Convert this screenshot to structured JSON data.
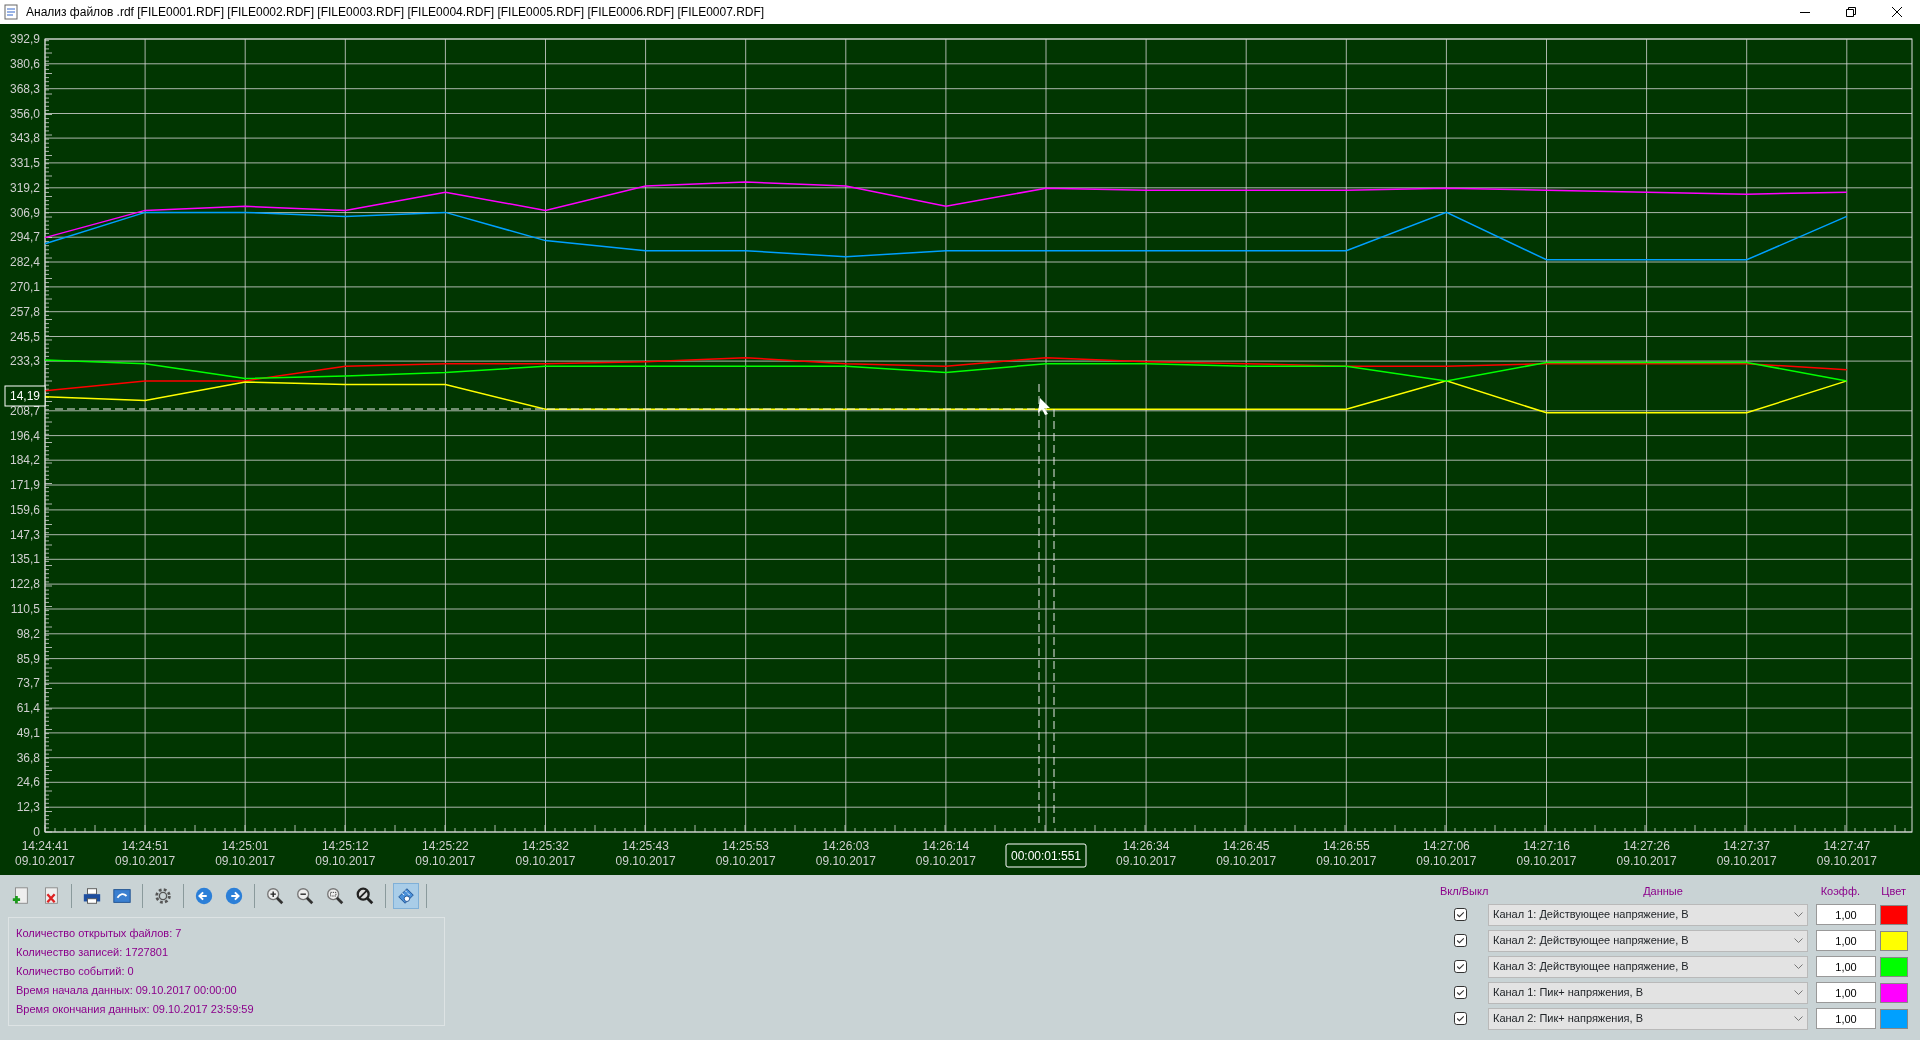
{
  "window": {
    "title": "Анализ файлов .rdf [FILE0001.RDF] [FILE0002.RDF] [FILE0003.RDF] [FILE0004.RDF] [FILE0005.RDF] [FILE0006.RDF] [FILE0007.RDF]"
  },
  "chart": {
    "cursor": {
      "y_value": "14,19",
      "time": "00:00:01:551"
    },
    "chart_data": {
      "type": "line",
      "grid": true,
      "ylim": [
        0,
        392.9
      ],
      "ref_lines": [
        {
          "axis": "y",
          "value": 209.6
        }
      ],
      "categories": [
        "14:24:41\n09.10.2017",
        "14:24:51\n09.10.2017",
        "14:25:01\n09.10.2017",
        "14:25:12\n09.10.2017",
        "14:25:22\n09.10.2017",
        "14:25:32\n09.10.2017",
        "14:25:43\n09.10.2017",
        "14:25:53\n09.10.2017",
        "14:26:03\n09.10.2017",
        "14:26:14\n09.10.2017",
        null,
        "14:26:34\n09.10.2017",
        "14:26:45\n09.10.2017",
        "14:26:55\n09.10.2017",
        "14:27:06\n09.10.2017",
        "14:27:16\n09.10.2017",
        "14:27:26\n09.10.2017",
        "14:27:37\n09.10.2017",
        "14:27:47\n09.10.2017"
      ],
      "yticks": [
        {
          "value": 392.9,
          "label": "392,9"
        },
        {
          "value": 380.6,
          "label": "380,6"
        },
        {
          "value": 368.3,
          "label": "368,3"
        },
        {
          "value": 356.0,
          "label": "356,0"
        },
        {
          "value": 343.8,
          "label": "343,8"
        },
        {
          "value": 331.5,
          "label": "331,5"
        },
        {
          "value": 319.2,
          "label": "319,2"
        },
        {
          "value": 306.9,
          "label": "306,9"
        },
        {
          "value": 294.7,
          "label": "294,7"
        },
        {
          "value": 282.4,
          "label": "282,4"
        },
        {
          "value": 270.1,
          "label": "270,1"
        },
        {
          "value": 257.8,
          "label": "257,8"
        },
        {
          "value": 245.5,
          "label": "245,5"
        },
        {
          "value": 233.3,
          "label": "233,3"
        },
        {
          "value": 208.7,
          "label": "208,7"
        },
        {
          "value": 196.4,
          "label": "196,4"
        },
        {
          "value": 184.2,
          "label": "184,2"
        },
        {
          "value": 171.9,
          "label": "171,9"
        },
        {
          "value": 159.6,
          "label": "159,6"
        },
        {
          "value": 147.3,
          "label": "147,3"
        },
        {
          "value": 135.1,
          "label": "135,1"
        },
        {
          "value": 122.8,
          "label": "122,8"
        },
        {
          "value": 110.5,
          "label": "110,5"
        },
        {
          "value": 98.2,
          "label": "98,2"
        },
        {
          "value": 85.9,
          "label": "85,9"
        },
        {
          "value": 73.7,
          "label": "73,7"
        },
        {
          "value": 61.4,
          "label": "61,4"
        },
        {
          "value": 49.1,
          "label": "49,1"
        },
        {
          "value": 36.8,
          "label": "36,8"
        },
        {
          "value": 24.6,
          "label": "24,6"
        },
        {
          "value": 12.3,
          "label": "12,3"
        },
        {
          "value": 0,
          "label": "0"
        }
      ],
      "series": [
        {
          "color": "#ff00ff",
          "values": [
            294.5,
            308,
            310,
            308,
            317,
            308,
            320,
            322,
            320,
            310,
            319,
            318,
            318,
            318,
            319,
            318,
            317,
            316,
            317
          ]
        },
        {
          "color": "#00a0ff",
          "values": [
            291.5,
            307,
            307,
            305,
            307,
            293,
            288,
            288,
            285,
            288,
            288,
            288,
            288,
            288,
            307,
            283.5,
            283.5,
            283.5,
            305
          ]
        },
        {
          "color": "#ff0000",
          "values": [
            218.6,
            223.5,
            223.5,
            230.8,
            232,
            232,
            233,
            235,
            232,
            230.8,
            235,
            233,
            232,
            230.8,
            230.8,
            232,
            232,
            232,
            229
          ]
        },
        {
          "color": "#ffff00",
          "values": [
            215.6,
            213.8,
            222.9,
            221.7,
            221.7,
            209.5,
            209.5,
            209.5,
            209.5,
            209.5,
            209.5,
            209.5,
            209.5,
            209.5,
            223.5,
            207.7,
            207.7,
            207.7,
            223.5
          ]
        },
        {
          "color": "#00ff00",
          "values": [
            233.8,
            232,
            224.7,
            226,
            227.7,
            230.8,
            230.8,
            230.8,
            230.8,
            227.7,
            232,
            232,
            230.8,
            230.8,
            223.5,
            232.6,
            232.6,
            232.6,
            223.5
          ]
        }
      ]
    }
  },
  "toolbar": [
    {
      "kind": "add-file",
      "selected": false
    },
    {
      "kind": "remove-file",
      "selected": false
    },
    {
      "kind": "separator"
    },
    {
      "kind": "print",
      "selected": false
    },
    {
      "kind": "export",
      "selected": false
    },
    {
      "kind": "separator"
    },
    {
      "kind": "settings",
      "selected": false
    },
    {
      "kind": "separator"
    },
    {
      "kind": "back",
      "selected": false
    },
    {
      "kind": "forward",
      "selected": false
    },
    {
      "kind": "separator"
    },
    {
      "kind": "zoom-in",
      "selected": false
    },
    {
      "kind": "zoom-out",
      "selected": false
    },
    {
      "kind": "zoom-area",
      "selected": false
    },
    {
      "kind": "zoom-reset",
      "selected": false
    },
    {
      "kind": "separator"
    },
    {
      "kind": "ruler",
      "selected": true
    },
    {
      "kind": "separator"
    }
  ],
  "info": [
    "Количество открытых файлов: 7",
    "Количество записей: 1727801",
    "Количество событий: 0",
    "Время начала данных: 09.10.2017 00:00:00",
    "Время окончания данных: 09.10.2017 23:59:59"
  ],
  "channels_panel": {
    "headers": [
      "Вкл/Выкл",
      "Данные",
      "Коэфф.",
      "Цвет"
    ],
    "channels": [
      {
        "checked": true,
        "data": "Канал 1: Действующее напряжение, В",
        "coefficient": "1,00",
        "color": "#ff0000"
      },
      {
        "checked": true,
        "data": "Канал 2: Действующее напряжение, В",
        "coefficient": "1,00",
        "color": "#ffff00"
      },
      {
        "checked": true,
        "data": "Канал 3: Действующее напряжение, В",
        "coefficient": "1,00",
        "color": "#00ff00"
      },
      {
        "checked": true,
        "data": "Канал 1: Пик+ напряжения, В",
        "coefficient": "1,00",
        "color": "#ff00ff"
      },
      {
        "checked": true,
        "data": "Канал 2: Пик+ напряжения, В",
        "coefficient": "1,00",
        "color": "#00a0ff"
      }
    ]
  }
}
